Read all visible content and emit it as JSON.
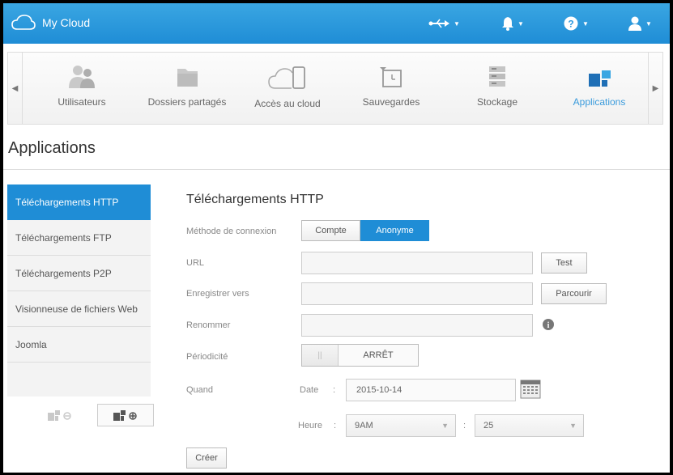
{
  "header": {
    "app_title": "My Cloud",
    "icons": [
      "usb-icon",
      "bell-icon",
      "help-icon",
      "user-icon"
    ]
  },
  "nav": {
    "items": [
      {
        "label": "Utilisateurs",
        "icon": "users-icon"
      },
      {
        "label": "Dossiers partagés",
        "icon": "folder-icon"
      },
      {
        "label": "Accès au cloud",
        "icon": "cloud-device-icon"
      },
      {
        "label": "Sauvegardes",
        "icon": "backup-icon"
      },
      {
        "label": "Stockage",
        "icon": "storage-icon"
      },
      {
        "label": "Applications",
        "icon": "applications-icon",
        "active": true
      }
    ]
  },
  "page": {
    "title": "Applications"
  },
  "sidebar": {
    "items": [
      {
        "label": "Téléchargements HTTP",
        "active": true
      },
      {
        "label": "Téléchargements FTP"
      },
      {
        "label": "Téléchargements P2P"
      },
      {
        "label": "Visionneuse de fichiers Web"
      },
      {
        "label": "Joomla"
      }
    ]
  },
  "form": {
    "title": "Téléchargements HTTP",
    "method_label": "Méthode de connexion",
    "method_options": [
      "Compte",
      "Anonyme"
    ],
    "method_selected": "Anonyme",
    "url_label": "URL",
    "url_value": "",
    "test_label": "Test",
    "save_to_label": "Enregistrer vers",
    "save_to_value": "",
    "browse_label": "Parcourir",
    "rename_label": "Renommer",
    "rename_value": "",
    "periodicity_label": "Périodicité",
    "periodicity_state": "ARRÊT",
    "when_label": "Quand",
    "date_label": "Date",
    "date_sep": ":",
    "date_value": "2015-10-14",
    "time_label": "Heure",
    "time_sep": ":",
    "hour_value": "9AM",
    "minute_sep": ":",
    "minute_value": "25",
    "create_label": "Créer"
  },
  "colors": {
    "accent": "#1f8dd6",
    "header": "#2b9ae0"
  }
}
